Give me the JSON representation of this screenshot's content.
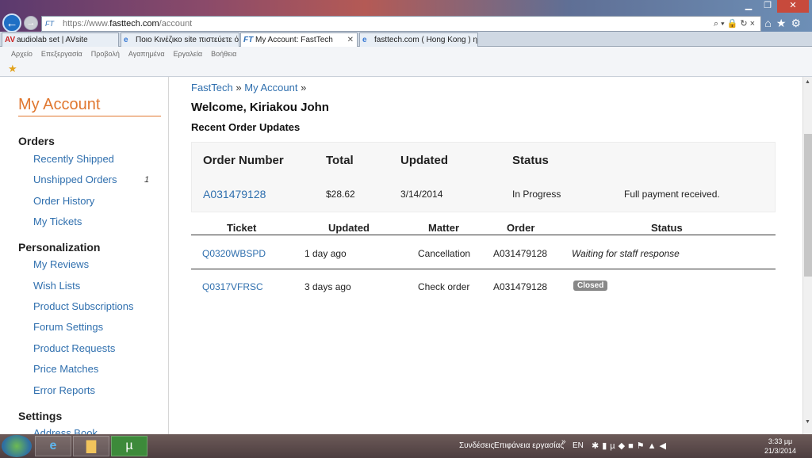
{
  "browser": {
    "url_prefix": "https://www.",
    "url_domain": "fasttech.com",
    "url_path": "/account",
    "favicon_label": "FT",
    "tabs": [
      {
        "icon": "AV",
        "label": "audiolab set | AVsite"
      },
      {
        "icon": "e",
        "label": "Ποιο Κινέζικο site πιστεύετε ότ..."
      },
      {
        "icon": "FT",
        "label": "My Account: FastTech"
      },
      {
        "icon": "e",
        "label": "fasttech.com ( Hong Kong ) η..."
      }
    ],
    "menu": [
      "Αρχείο",
      "Επεξεργασία",
      "Προβολή",
      "Αγαπημένα",
      "Εργαλεία",
      "Βοήθεια"
    ]
  },
  "sidebar": {
    "title": "My Account",
    "sections": [
      {
        "heading": "Orders",
        "items": [
          {
            "label": "Recently Shipped"
          },
          {
            "label": "Unshipped Orders",
            "count": "1"
          },
          {
            "label": "Order History"
          },
          {
            "label": "My Tickets"
          }
        ]
      },
      {
        "heading": "Personalization",
        "items": [
          {
            "label": "My Reviews"
          },
          {
            "label": "Wish Lists"
          },
          {
            "label": "Product Subscriptions"
          },
          {
            "label": "Forum Settings"
          },
          {
            "label": "Product Requests"
          },
          {
            "label": "Price Matches"
          },
          {
            "label": "Error Reports"
          }
        ]
      },
      {
        "heading": "Settings",
        "items": [
          {
            "label": "Address Book"
          }
        ]
      }
    ]
  },
  "breadcrumb": {
    "home": "FastTech",
    "sep": "»",
    "current": "My Account",
    "trail": "»"
  },
  "welcome": "Welcome, Kiriakou John",
  "recent_heading": "Recent Order Updates",
  "orders": {
    "headers": [
      "Order Number",
      "Total",
      "Updated",
      "Status"
    ],
    "rows": [
      {
        "number": "A031479128",
        "total": "$28.62",
        "updated": "3/14/2014",
        "status": "In Progress",
        "note": "Full payment received."
      }
    ]
  },
  "tickets": {
    "headers": [
      "Ticket",
      "Updated",
      "Matter",
      "Order",
      "Status"
    ],
    "rows": [
      {
        "ticket": "Q0320WBSPD",
        "updated": "1 day ago",
        "matter": "Cancellation",
        "order": "A031479128",
        "status": "Waiting for staff response"
      },
      {
        "ticket": "Q0317VFRSC",
        "updated": "3 days ago",
        "matter": "Check order",
        "order": "A031479128",
        "status": "Closed"
      }
    ]
  },
  "taskbar": {
    "labels": [
      "Συνδέσεις",
      "Επιφάνεια εργασίας"
    ],
    "chevron": "»",
    "lang": "EN",
    "time": "3:33 μμ",
    "date": "21/3/2014"
  }
}
